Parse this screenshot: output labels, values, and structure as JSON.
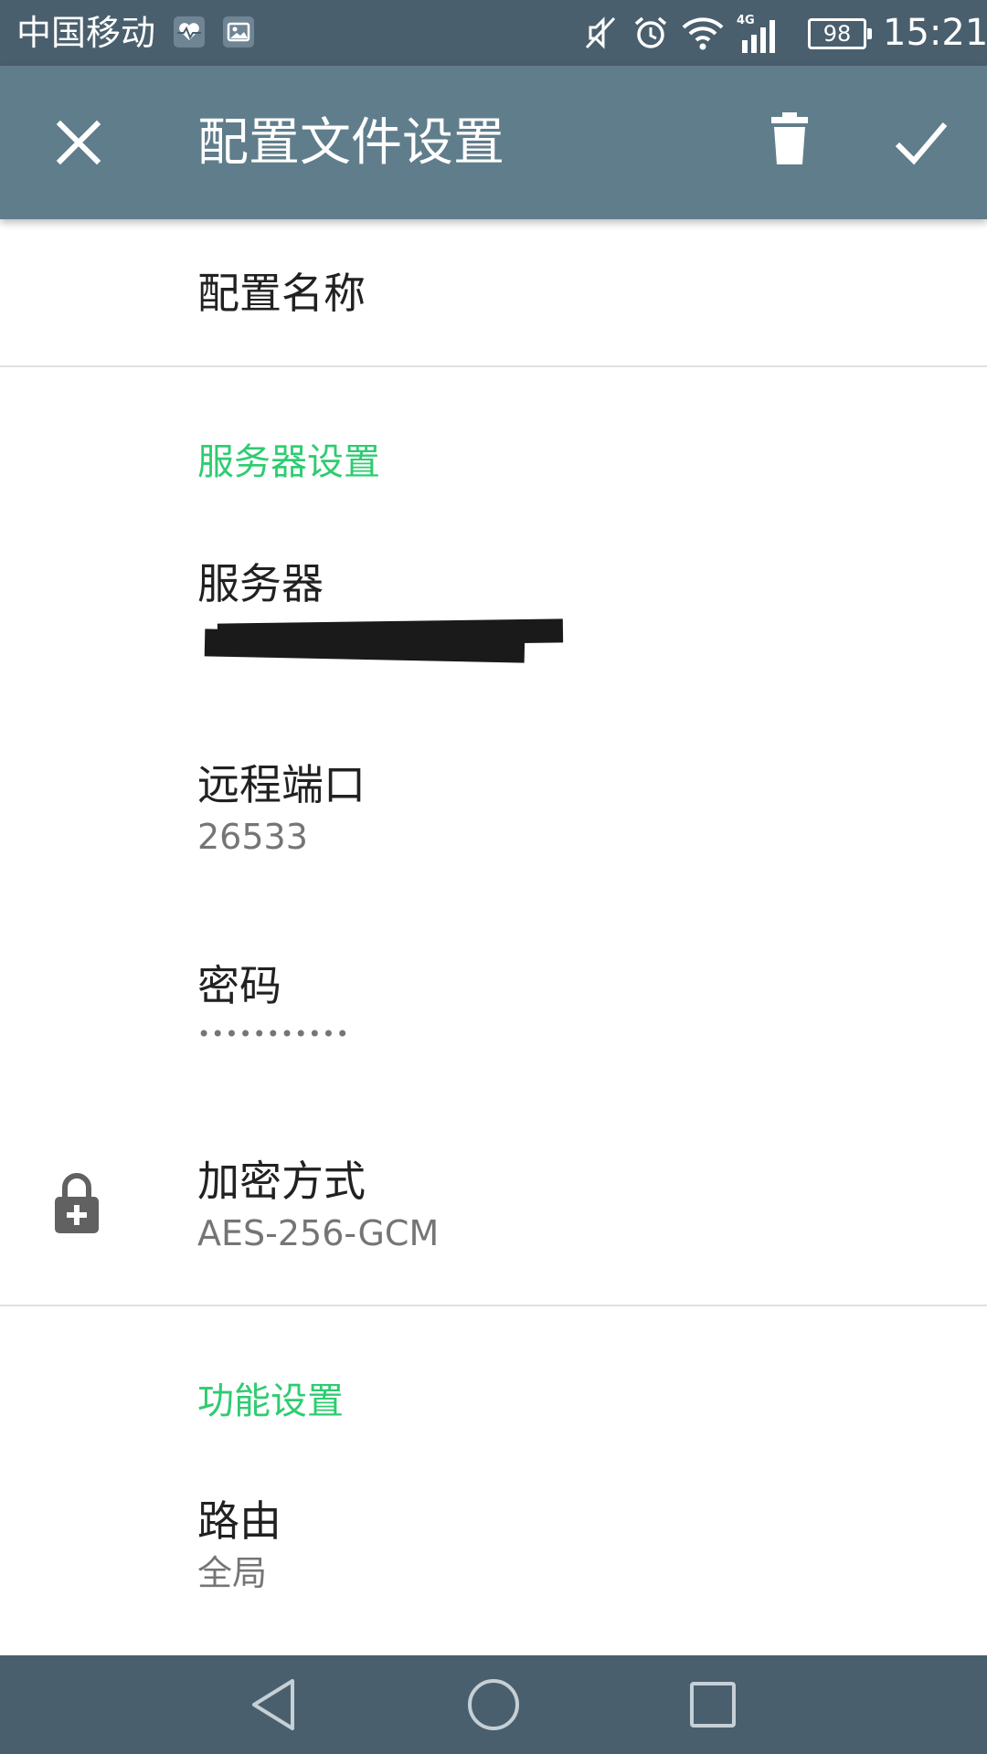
{
  "status_bar": {
    "carrier": "中国移动",
    "network_type": "4G",
    "battery": "98",
    "time": "15:21",
    "icons": [
      "heart-monitor-icon",
      "image-icon",
      "mute-icon",
      "alarm-icon",
      "wifi-icon",
      "signal-icon"
    ]
  },
  "app_bar": {
    "title": "配置文件设置",
    "close_icon": "close-icon",
    "delete_icon": "trash-icon",
    "confirm_icon": "check-icon"
  },
  "profile": {
    "name_title": "配置名称"
  },
  "server_section": {
    "header": "服务器设置",
    "server_title": "服务器",
    "server_value": "",
    "port_title": "远程端口",
    "port_value": "26533",
    "password_title": "密码",
    "password_value": "•••••••••••",
    "encryption_title": "加密方式",
    "encryption_value": "AES-256-GCM",
    "encryption_icon": "lock-plus-icon"
  },
  "feature_section": {
    "header": "功能设置",
    "route_title": "路由",
    "route_value": "全局"
  },
  "nav_bar": {
    "back_icon": "back-triangle-icon",
    "home_icon": "home-circle-icon",
    "recents_icon": "recents-square-icon"
  },
  "colors": {
    "status_bar": "#4a5f6d",
    "app_bar": "#607d8b",
    "section_header": "#2ecc71",
    "primary_text": "#212121",
    "secondary_text": "#757575"
  }
}
